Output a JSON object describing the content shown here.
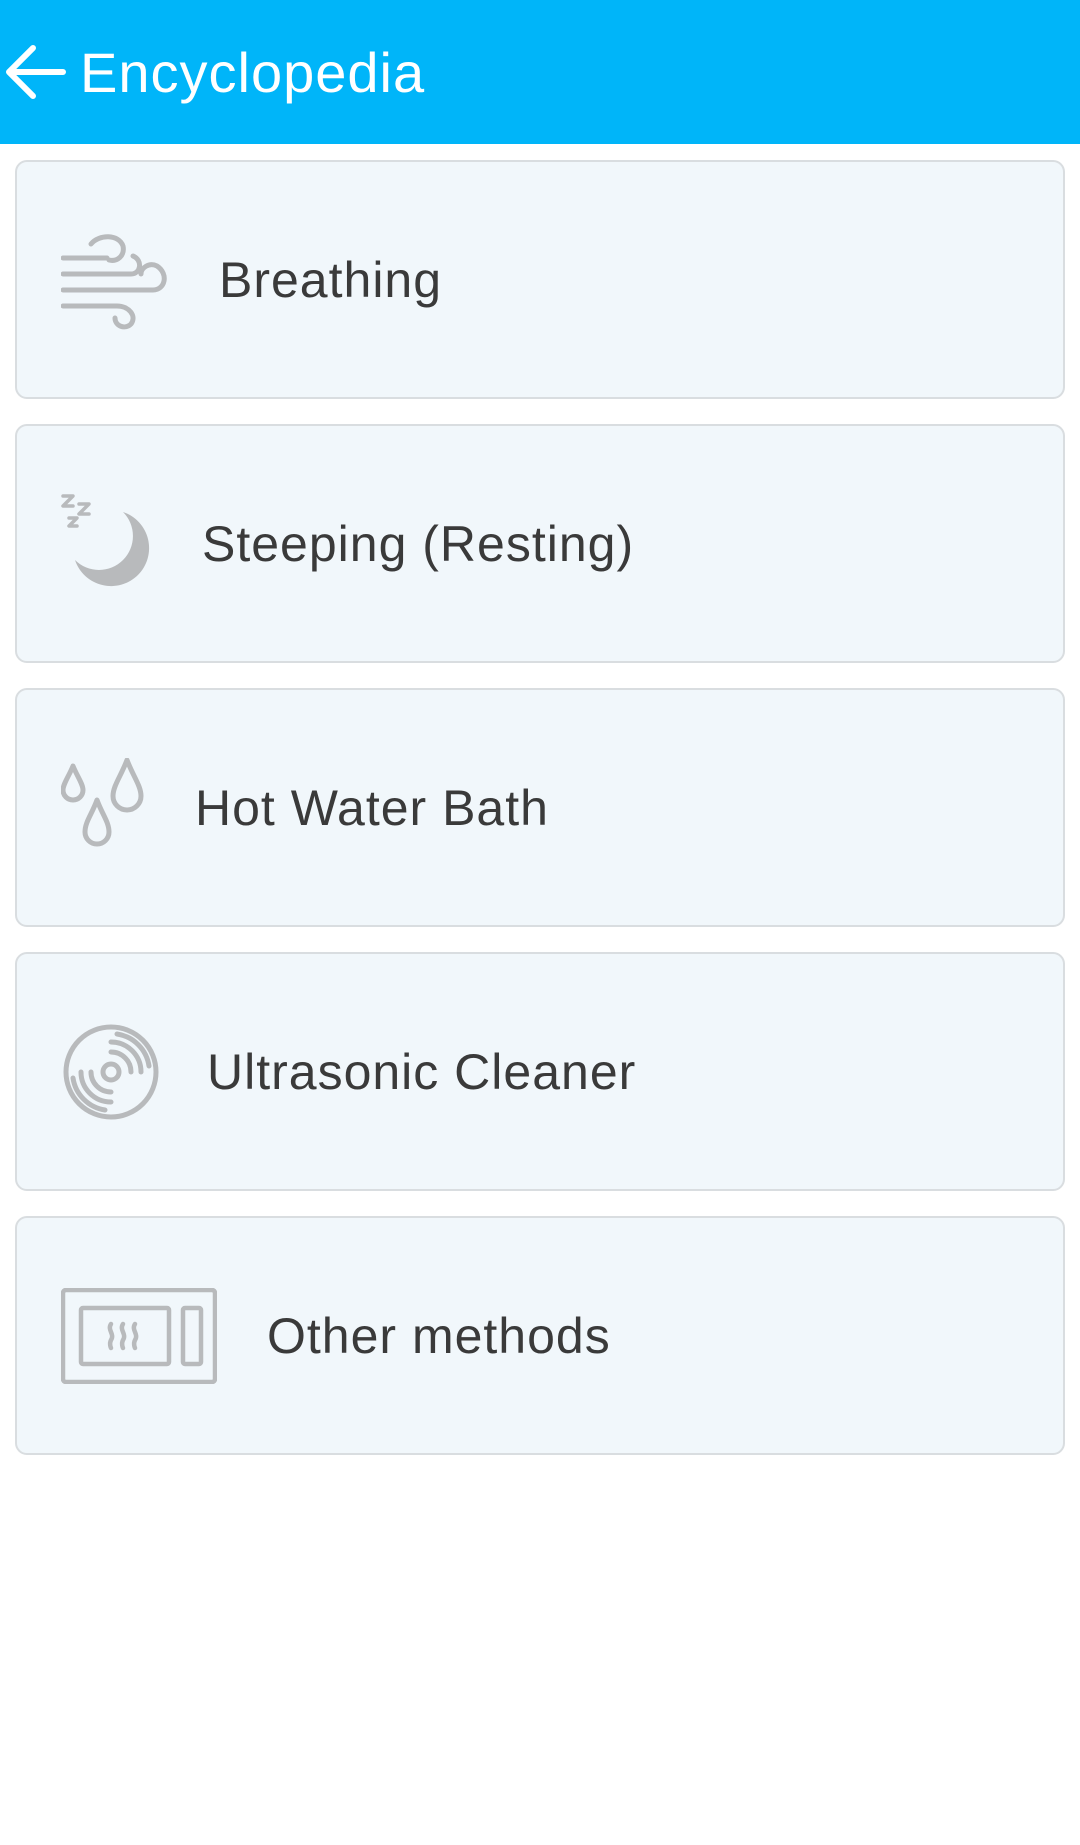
{
  "header": {
    "title": "Encyclopedia",
    "back_icon": "arrow-left-icon",
    "background_color": "#00b5f9"
  },
  "items": [
    {
      "label": "Breathing",
      "icon": "wind-icon"
    },
    {
      "label": "Steeping (Resting)",
      "icon": "moon-sleep-icon"
    },
    {
      "label": "Hot Water Bath",
      "icon": "water-drops-icon"
    },
    {
      "label": "Ultrasonic Cleaner",
      "icon": "ultrasonic-icon"
    },
    {
      "label": "Other methods",
      "icon": "microwave-icon"
    }
  ]
}
